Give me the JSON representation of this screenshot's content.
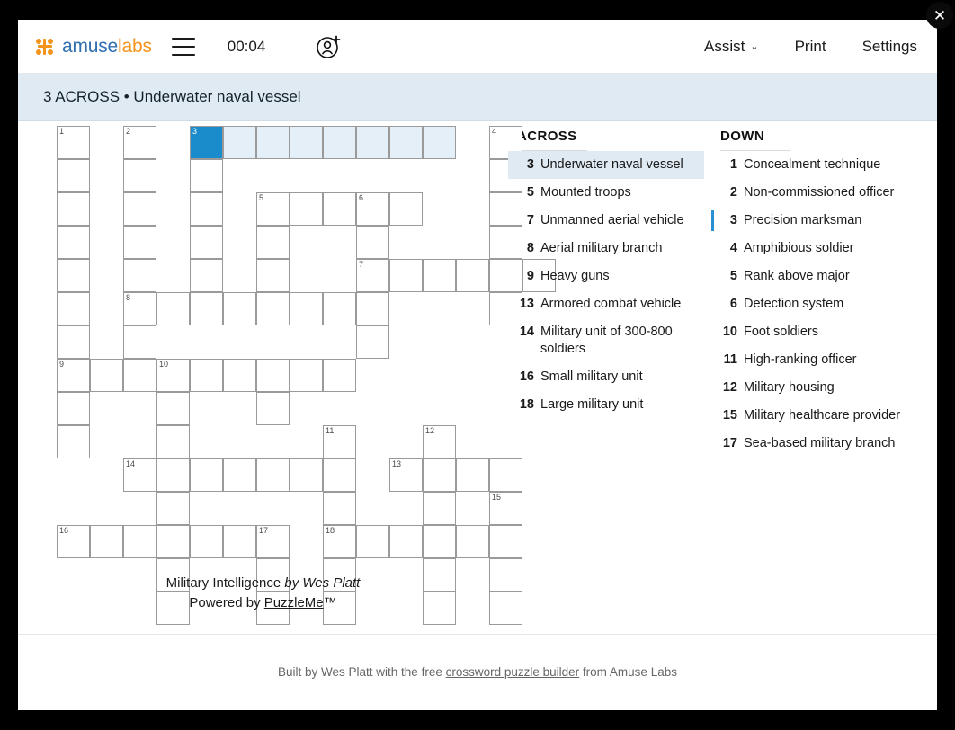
{
  "window": {
    "close_label": "✕"
  },
  "header": {
    "logo_mark": "amuselabs-logo-icon",
    "logo_first": "amuse",
    "logo_second": "labs",
    "menu_icon": "hamburger-menu-icon",
    "timer": "00:04",
    "add_user_icon": "add-user-icon",
    "assist_label": "Assist",
    "assist_caret": "⌄",
    "print_label": "Print",
    "settings_label": "Settings"
  },
  "clue_bar": {
    "text": "3 ACROSS • Underwater naval vessel"
  },
  "grid": {
    "cell_size": 37,
    "cols": 15,
    "rows": 14,
    "current_cell": {
      "row": 0,
      "col": 4
    },
    "highlight_color": "#e4eff7",
    "current_color": "#1a8bcb",
    "cells": [
      {
        "row": 0,
        "col": 0,
        "num": "1",
        "state": "plain"
      },
      {
        "row": 0,
        "col": 2,
        "num": "2",
        "state": "plain"
      },
      {
        "row": 0,
        "col": 4,
        "num": "3",
        "state": "current"
      },
      {
        "row": 0,
        "col": 5,
        "num": "",
        "state": "highlight"
      },
      {
        "row": 0,
        "col": 6,
        "num": "",
        "state": "highlight"
      },
      {
        "row": 0,
        "col": 7,
        "num": "",
        "state": "highlight"
      },
      {
        "row": 0,
        "col": 8,
        "num": "",
        "state": "highlight"
      },
      {
        "row": 0,
        "col": 9,
        "num": "",
        "state": "highlight"
      },
      {
        "row": 0,
        "col": 10,
        "num": "",
        "state": "highlight"
      },
      {
        "row": 0,
        "col": 11,
        "num": "",
        "state": "highlight"
      },
      {
        "row": 0,
        "col": 13,
        "num": "4",
        "state": "plain"
      },
      {
        "row": 1,
        "col": 0,
        "num": "",
        "state": "plain"
      },
      {
        "row": 1,
        "col": 2,
        "num": "",
        "state": "plain"
      },
      {
        "row": 1,
        "col": 4,
        "num": "",
        "state": "plain"
      },
      {
        "row": 1,
        "col": 13,
        "num": "",
        "state": "plain"
      },
      {
        "row": 2,
        "col": 0,
        "num": "",
        "state": "plain"
      },
      {
        "row": 2,
        "col": 2,
        "num": "",
        "state": "plain"
      },
      {
        "row": 2,
        "col": 4,
        "num": "",
        "state": "plain"
      },
      {
        "row": 2,
        "col": 6,
        "num": "5",
        "state": "plain"
      },
      {
        "row": 2,
        "col": 7,
        "num": "",
        "state": "plain"
      },
      {
        "row": 2,
        "col": 8,
        "num": "",
        "state": "plain"
      },
      {
        "row": 2,
        "col": 9,
        "num": "6",
        "state": "plain"
      },
      {
        "row": 2,
        "col": 10,
        "num": "",
        "state": "plain"
      },
      {
        "row": 2,
        "col": 13,
        "num": "",
        "state": "plain"
      },
      {
        "row": 3,
        "col": 0,
        "num": "",
        "state": "plain"
      },
      {
        "row": 3,
        "col": 2,
        "num": "",
        "state": "plain"
      },
      {
        "row": 3,
        "col": 4,
        "num": "",
        "state": "plain"
      },
      {
        "row": 3,
        "col": 6,
        "num": "",
        "state": "plain"
      },
      {
        "row": 3,
        "col": 9,
        "num": "",
        "state": "plain"
      },
      {
        "row": 3,
        "col": 13,
        "num": "",
        "state": "plain"
      },
      {
        "row": 4,
        "col": 0,
        "num": "",
        "state": "plain"
      },
      {
        "row": 4,
        "col": 2,
        "num": "",
        "state": "plain"
      },
      {
        "row": 4,
        "col": 4,
        "num": "",
        "state": "plain"
      },
      {
        "row": 4,
        "col": 6,
        "num": "",
        "state": "plain"
      },
      {
        "row": 4,
        "col": 9,
        "num": "7",
        "state": "plain"
      },
      {
        "row": 4,
        "col": 10,
        "num": "",
        "state": "plain"
      },
      {
        "row": 4,
        "col": 11,
        "num": "",
        "state": "plain"
      },
      {
        "row": 4,
        "col": 12,
        "num": "",
        "state": "plain"
      },
      {
        "row": 4,
        "col": 13,
        "num": "",
        "state": "plain"
      },
      {
        "row": 4,
        "col": 14,
        "num": "",
        "state": "plain"
      },
      {
        "row": 5,
        "col": 0,
        "num": "",
        "state": "plain"
      },
      {
        "row": 5,
        "col": 2,
        "num": "8",
        "state": "plain"
      },
      {
        "row": 5,
        "col": 3,
        "num": "",
        "state": "plain"
      },
      {
        "row": 5,
        "col": 4,
        "num": "",
        "state": "plain"
      },
      {
        "row": 5,
        "col": 5,
        "num": "",
        "state": "plain"
      },
      {
        "row": 5,
        "col": 6,
        "num": "",
        "state": "plain"
      },
      {
        "row": 5,
        "col": 7,
        "num": "",
        "state": "plain"
      },
      {
        "row": 5,
        "col": 8,
        "num": "",
        "state": "plain"
      },
      {
        "row": 5,
        "col": 9,
        "num": "",
        "state": "plain"
      },
      {
        "row": 5,
        "col": 13,
        "num": "",
        "state": "plain"
      },
      {
        "row": 6,
        "col": 0,
        "num": "",
        "state": "plain"
      },
      {
        "row": 6,
        "col": 2,
        "num": "",
        "state": "plain"
      },
      {
        "row": 6,
        "col": 9,
        "num": "",
        "state": "plain"
      },
      {
        "row": 7,
        "col": 0,
        "num": "9",
        "state": "plain"
      },
      {
        "row": 7,
        "col": 1,
        "num": "",
        "state": "plain"
      },
      {
        "row": 7,
        "col": 2,
        "num": "",
        "state": "plain"
      },
      {
        "row": 7,
        "col": 3,
        "num": "10",
        "state": "plain"
      },
      {
        "row": 7,
        "col": 4,
        "num": "",
        "state": "plain"
      },
      {
        "row": 7,
        "col": 5,
        "num": "",
        "state": "plain"
      },
      {
        "row": 7,
        "col": 6,
        "num": "",
        "state": "plain"
      },
      {
        "row": 7,
        "col": 7,
        "num": "",
        "state": "plain"
      },
      {
        "row": 7,
        "col": 8,
        "num": "",
        "state": "plain"
      },
      {
        "row": 8,
        "col": 0,
        "num": "",
        "state": "plain"
      },
      {
        "row": 8,
        "col": 3,
        "num": "",
        "state": "plain"
      },
      {
        "row": 8,
        "col": 6,
        "num": "",
        "state": "plain"
      },
      {
        "row": 9,
        "col": 0,
        "num": "",
        "state": "plain"
      },
      {
        "row": 9,
        "col": 3,
        "num": "",
        "state": "plain"
      },
      {
        "row": 9,
        "col": 8,
        "num": "11",
        "state": "plain"
      },
      {
        "row": 9,
        "col": 11,
        "num": "12",
        "state": "plain"
      },
      {
        "row": 10,
        "col": 2,
        "num": "14",
        "state": "plain"
      },
      {
        "row": 10,
        "col": 3,
        "num": "",
        "state": "plain"
      },
      {
        "row": 10,
        "col": 4,
        "num": "",
        "state": "plain"
      },
      {
        "row": 10,
        "col": 5,
        "num": "",
        "state": "plain"
      },
      {
        "row": 10,
        "col": 6,
        "num": "",
        "state": "plain"
      },
      {
        "row": 10,
        "col": 7,
        "num": "",
        "state": "plain"
      },
      {
        "row": 10,
        "col": 8,
        "num": "",
        "state": "plain"
      },
      {
        "row": 10,
        "col": 10,
        "num": "13",
        "state": "plain"
      },
      {
        "row": 10,
        "col": 11,
        "num": "",
        "state": "plain"
      },
      {
        "row": 10,
        "col": 12,
        "num": "",
        "state": "plain"
      },
      {
        "row": 10,
        "col": 13,
        "num": "",
        "state": "plain"
      },
      {
        "row": 11,
        "col": 3,
        "num": "",
        "state": "plain"
      },
      {
        "row": 11,
        "col": 8,
        "num": "",
        "state": "plain"
      },
      {
        "row": 11,
        "col": 11,
        "num": "",
        "state": "plain"
      },
      {
        "row": 11,
        "col": 13,
        "num": "15",
        "state": "plain"
      },
      {
        "row": 12,
        "col": 0,
        "num": "16",
        "state": "plain"
      },
      {
        "row": 12,
        "col": 1,
        "num": "",
        "state": "plain"
      },
      {
        "row": 12,
        "col": 2,
        "num": "",
        "state": "plain"
      },
      {
        "row": 12,
        "col": 3,
        "num": "",
        "state": "plain"
      },
      {
        "row": 12,
        "col": 4,
        "num": "",
        "state": "plain"
      },
      {
        "row": 12,
        "col": 5,
        "num": "",
        "state": "plain"
      },
      {
        "row": 12,
        "col": 6,
        "num": "17",
        "state": "plain"
      },
      {
        "row": 12,
        "col": 8,
        "num": "18",
        "state": "plain"
      },
      {
        "row": 12,
        "col": 9,
        "num": "",
        "state": "plain"
      },
      {
        "row": 12,
        "col": 10,
        "num": "",
        "state": "plain"
      },
      {
        "row": 12,
        "col": 11,
        "num": "",
        "state": "plain"
      },
      {
        "row": 12,
        "col": 12,
        "num": "",
        "state": "plain"
      },
      {
        "row": 12,
        "col": 13,
        "num": "",
        "state": "plain"
      },
      {
        "row": 13,
        "col": 3,
        "num": "",
        "state": "plain"
      },
      {
        "row": 13,
        "col": 6,
        "num": "",
        "state": "plain"
      },
      {
        "row": 13,
        "col": 8,
        "num": "",
        "state": "plain"
      },
      {
        "row": 13,
        "col": 11,
        "num": "",
        "state": "plain"
      },
      {
        "row": 13,
        "col": 13,
        "num": "",
        "state": "plain"
      },
      {
        "row": 14,
        "col": 3,
        "num": "",
        "state": "plain"
      },
      {
        "row": 14,
        "col": 6,
        "num": "",
        "state": "plain"
      },
      {
        "row": 14,
        "col": 8,
        "num": "",
        "state": "plain"
      },
      {
        "row": 14,
        "col": 11,
        "num": "",
        "state": "plain"
      },
      {
        "row": 14,
        "col": 13,
        "num": "",
        "state": "plain"
      }
    ]
  },
  "byline": {
    "title": "Military Intelligence",
    "author": "by Wes Platt",
    "powered_prefix": "Powered by ",
    "powered_link": "PuzzleMe",
    "powered_suffix": "™"
  },
  "clues": {
    "across_heading": "ACROSS",
    "down_heading": "DOWN",
    "across": [
      {
        "num": "3",
        "text": "Underwater naval vessel",
        "active": true,
        "marked": false
      },
      {
        "num": "5",
        "text": "Mounted troops",
        "active": false,
        "marked": false
      },
      {
        "num": "7",
        "text": "Unmanned aerial vehicle",
        "active": false,
        "marked": false
      },
      {
        "num": "8",
        "text": "Aerial military branch",
        "active": false,
        "marked": false
      },
      {
        "num": "9",
        "text": "Heavy guns",
        "active": false,
        "marked": false
      },
      {
        "num": "13",
        "text": "Armored combat vehicle",
        "active": false,
        "marked": false
      },
      {
        "num": "14",
        "text": "Military unit of 300-800 soldiers",
        "active": false,
        "marked": false
      },
      {
        "num": "16",
        "text": "Small military unit",
        "active": false,
        "marked": false
      },
      {
        "num": "18",
        "text": "Large military unit",
        "active": false,
        "marked": false
      }
    ],
    "down": [
      {
        "num": "1",
        "text": "Concealment technique",
        "active": false,
        "marked": false
      },
      {
        "num": "2",
        "text": "Non-commissioned officer",
        "active": false,
        "marked": false
      },
      {
        "num": "3",
        "text": "Precision marksman",
        "active": false,
        "marked": true
      },
      {
        "num": "4",
        "text": "Amphibious soldier",
        "active": false,
        "marked": false
      },
      {
        "num": "5",
        "text": "Rank above major",
        "active": false,
        "marked": false
      },
      {
        "num": "6",
        "text": "Detection system",
        "active": false,
        "marked": false
      },
      {
        "num": "10",
        "text": "Foot soldiers",
        "active": false,
        "marked": false
      },
      {
        "num": "11",
        "text": "High-ranking officer",
        "active": false,
        "marked": false
      },
      {
        "num": "12",
        "text": "Military housing",
        "active": false,
        "marked": false
      },
      {
        "num": "15",
        "text": "Military healthcare provider",
        "active": false,
        "marked": false
      },
      {
        "num": "17",
        "text": "Sea-based military branch",
        "active": false,
        "marked": false
      }
    ]
  },
  "footer": {
    "prefix": "Built by Wes Platt with the free ",
    "link": "crossword puzzle builder",
    "suffix": " from Amuse Labs"
  }
}
